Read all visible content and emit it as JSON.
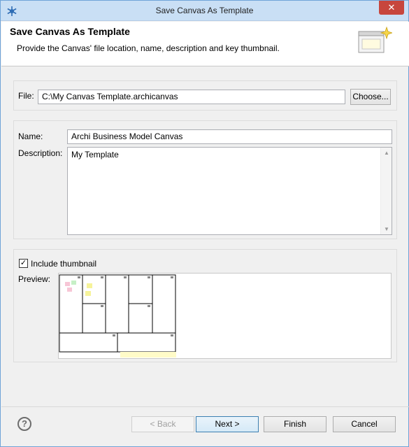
{
  "window": {
    "title": "Save Canvas As Template",
    "close_label": "✕"
  },
  "header": {
    "title": "Save Canvas As Template",
    "description": "Provide the Canvas' file location, name, description and key thumbnail."
  },
  "file_group": {
    "label": "File:",
    "value": "C:\\My Canvas Template.archicanvas",
    "choose_button": "Choose..."
  },
  "details_group": {
    "name_label": "Name:",
    "name_value": "Archi Business Model Canvas",
    "description_label": "Description:",
    "description_value": "My Template"
  },
  "thumbnail_group": {
    "include_label": "Include thumbnail",
    "include_checked": true,
    "preview_label": "Preview:"
  },
  "footer": {
    "help_label": "?",
    "back_button": "< Back",
    "next_button": "Next >",
    "finish_button": "Finish",
    "cancel_button": "Cancel"
  }
}
